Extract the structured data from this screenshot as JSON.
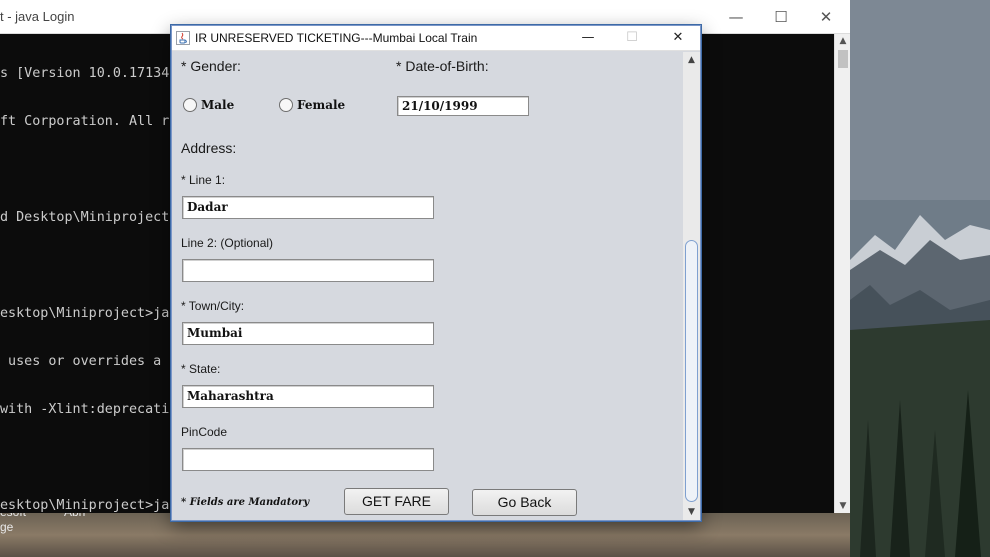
{
  "console": {
    "title": "t - java  Login",
    "lines": [
      "s [Version 10.0.17134",
      "ft Corporation. All r",
      "",
      "d Desktop\\Miniproject",
      "",
      "esktop\\Miniproject>ja",
      " uses or overrides a ",
      "with -Xlint:deprecati",
      "",
      "esktop\\Miniproject>ja"
    ],
    "controls": {
      "minimize": "—",
      "maximize": "☐",
      "close": "✕"
    }
  },
  "taskbar": {
    "item1": "esoft",
    "item2": "Abh",
    "item3": "ge"
  },
  "app": {
    "title": "IR UNRESERVED TICKETING---Mumbai Local Train",
    "controls": {
      "minimize": "—",
      "maximize": "☐",
      "close": "✕"
    },
    "gender_label": "* Gender:",
    "dob_label": "* Date-of-Birth:",
    "gender_options": {
      "male": "Male",
      "female": "Female"
    },
    "dob_value": "21/10/1999",
    "address_label": "Address:",
    "line1_label": "* Line 1:",
    "line1_value": "Dadar",
    "line2_label": "Line 2: (Optional)",
    "line2_value": "",
    "town_label": "* Town/City:",
    "town_value": "Mumbai",
    "state_label": "* State:",
    "state_value": "Maharashtra",
    "pincode_label": "PinCode",
    "pincode_value": "",
    "mandatory_note": "* Fields are Mandatory",
    "get_fare_button": "GET FARE",
    "go_back_button": "Go Back"
  },
  "colors": {
    "app_bg": "#d6d9df",
    "window_border": "#3d6aa6",
    "console_bg": "#0c0c0c",
    "console_text": "#cccccc"
  }
}
